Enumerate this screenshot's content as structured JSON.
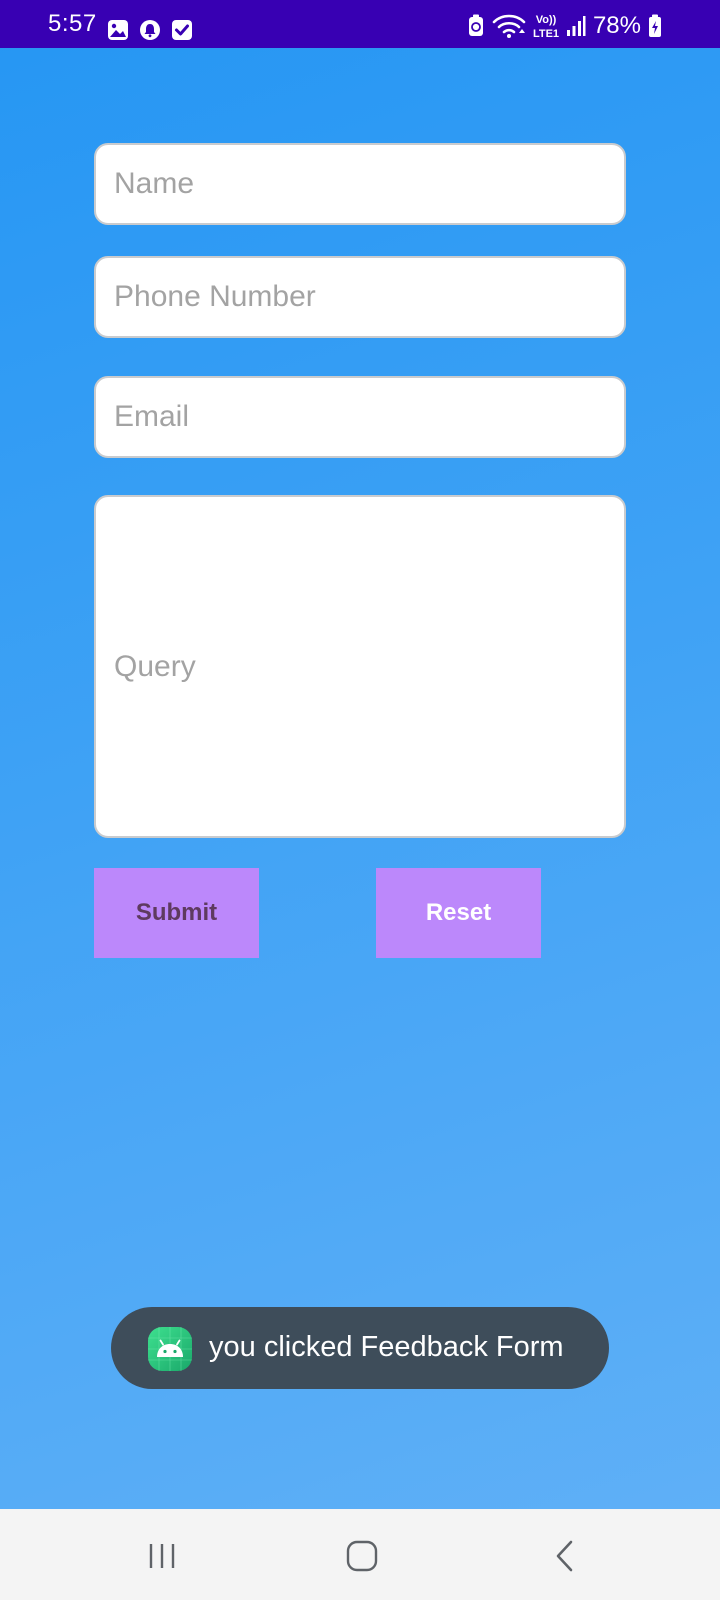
{
  "status_bar": {
    "time": "5:57",
    "battery": "78%",
    "network_label": "Vo)) LTE1",
    "left_icons": [
      "gallery-icon",
      "alert-icon",
      "checkbox-icon"
    ],
    "right_icons": [
      "recycle-icon",
      "wifi-icon",
      "lte-icon",
      "signal-icon",
      "battery-charging-icon"
    ],
    "background": "#3800b3"
  },
  "form": {
    "name_placeholder": "Name",
    "phone_placeholder": "Phone Number",
    "email_placeholder": "Email",
    "query_placeholder": "Query"
  },
  "buttons": {
    "submit_label": "Submit",
    "reset_label": "Reset",
    "background": "#bc88fb"
  },
  "toast": {
    "message": "you clicked Feedback Form",
    "icon": "android-app-icon"
  },
  "nav_bar": {
    "buttons": [
      "recents-icon",
      "home-icon",
      "back-icon"
    ]
  },
  "colors": {
    "background_top": "#2596f3",
    "background_bottom": "#62b1f7",
    "toast_background": "#3e4d5a"
  }
}
